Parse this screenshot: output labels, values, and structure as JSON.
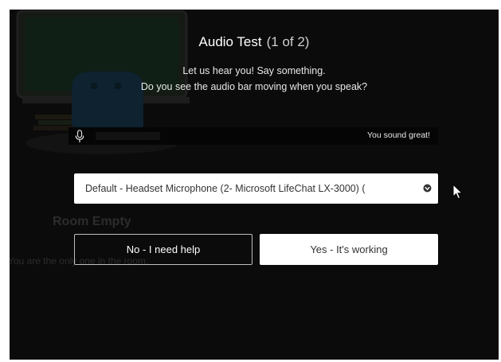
{
  "background": {
    "room_title": "Room Empty",
    "room_subtitle": "You are the only one in the room."
  },
  "dialog": {
    "title": "Audio Test",
    "step": "(1 of 2)",
    "instruction_line1": "Let us hear you! Say something.",
    "instruction_line2": "Do you see the audio bar moving when you speak?",
    "audio_bar": {
      "icon": "microphone-icon",
      "level": 0.22,
      "feedback": "You sound great!"
    },
    "device_select": {
      "value": "Default - Headset Microphone (2- Microsoft LifeChat LX-3000) (",
      "icon": "chevron-down-icon"
    },
    "buttons": {
      "no_label": "No - I need help",
      "yes_label": "Yes - It's working"
    }
  }
}
